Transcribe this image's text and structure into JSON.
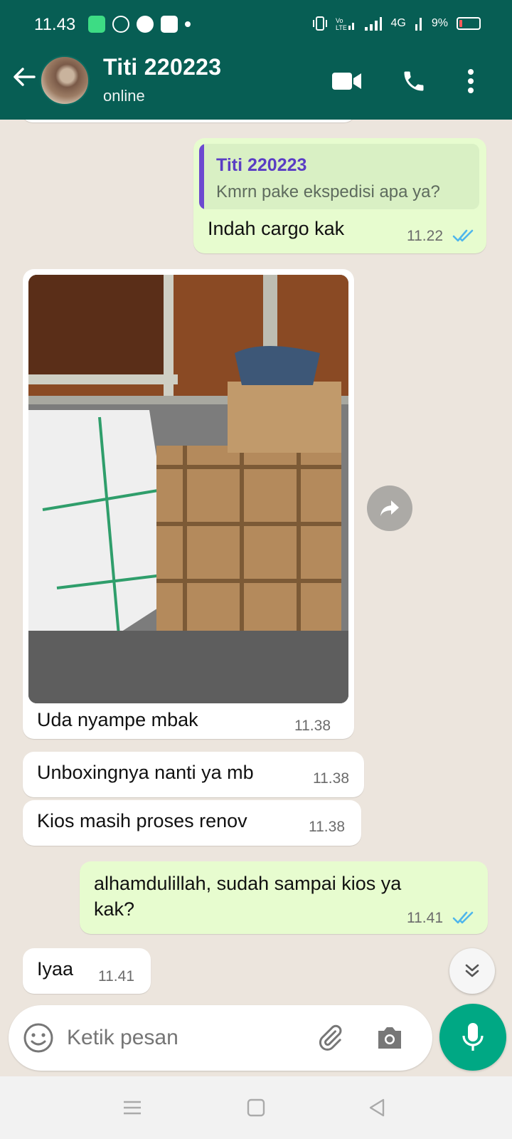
{
  "status_bar": {
    "time": "11.43",
    "network": "4G",
    "battery": "9%"
  },
  "header": {
    "contact_name": "Titi 220223",
    "presence": "online",
    "icons": [
      "back-arrow-icon",
      "video-call-icon",
      "phone-icon",
      "more-vertical-icon"
    ]
  },
  "messages": [
    {
      "direction": "outgoing",
      "quote": {
        "author": "Titi 220223",
        "text": "Kmrn pake ekspedisi apa ya?"
      },
      "text": "Indah cargo kak",
      "time": "11.22",
      "read": true
    },
    {
      "direction": "incoming",
      "image": "photo-of-wooden-crates-and-boxes",
      "text": "Uda nyampe mbak",
      "time": "11.38"
    },
    {
      "direction": "incoming",
      "text": "Unboxingnya nanti ya mb",
      "time": "11.38"
    },
    {
      "direction": "incoming",
      "text": "Kios masih proses renov",
      "time": "11.38"
    },
    {
      "direction": "outgoing",
      "text_lines": [
        "alhamdulillah, sudah sampai kios ya",
        "kak?"
      ],
      "time": "11.41",
      "read": true
    },
    {
      "direction": "incoming",
      "text": "Iyaa",
      "time": "11.41"
    }
  ],
  "composer": {
    "placeholder": "Ketik pesan",
    "icons": [
      "emoji-icon",
      "attach-icon",
      "camera-icon",
      "mic-icon"
    ]
  },
  "colors": {
    "header": "#075E54",
    "outgoing_bubble": "#E7FCCF",
    "incoming_bubble": "#FFFFFF",
    "chat_background": "#ECE5DD",
    "read_ticks": "#4FB6EC",
    "accent": "#00A884"
  }
}
